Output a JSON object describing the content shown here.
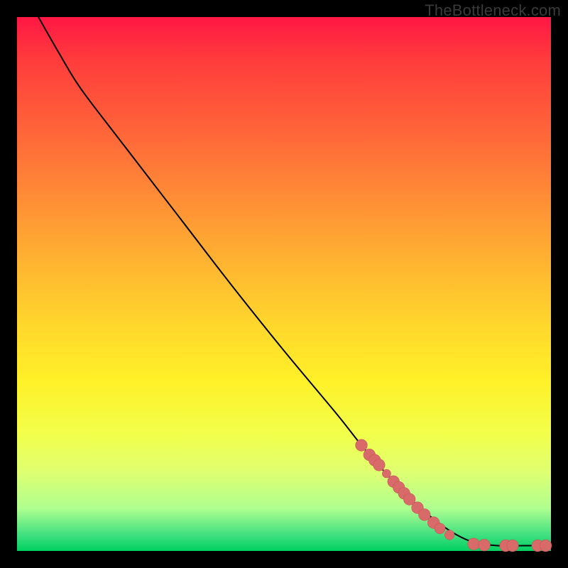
{
  "attribution": "TheBottleneck.com",
  "colors": {
    "background": "#000000",
    "curve": "#000000",
    "marker_fill": "#d86a6a",
    "marker_stroke": "#c75858"
  },
  "chart_data": {
    "type": "line",
    "title": "",
    "xlabel": "",
    "ylabel": "",
    "xlim": [
      0,
      100
    ],
    "ylim": [
      0,
      100
    ],
    "grid": false,
    "legend": false,
    "curve_points_pct": [
      {
        "x": 4,
        "y": 100
      },
      {
        "x": 8,
        "y": 93
      },
      {
        "x": 12,
        "y": 86.5
      },
      {
        "x": 20,
        "y": 76
      },
      {
        "x": 30,
        "y": 63
      },
      {
        "x": 40,
        "y": 50
      },
      {
        "x": 50,
        "y": 37.5
      },
      {
        "x": 60,
        "y": 25.5
      },
      {
        "x": 66,
        "y": 18
      },
      {
        "x": 74,
        "y": 9.5
      },
      {
        "x": 80,
        "y": 4.5
      },
      {
        "x": 85,
        "y": 1.8
      },
      {
        "x": 90,
        "y": 1.0
      },
      {
        "x": 95,
        "y": 1.0
      },
      {
        "x": 99,
        "y": 1.0
      }
    ],
    "markers_pct": [
      {
        "x": 64.5,
        "y": 19.8,
        "r": 1.1
      },
      {
        "x": 66.0,
        "y": 18.0,
        "r": 1.1
      },
      {
        "x": 67.0,
        "y": 17.0,
        "r": 1.1
      },
      {
        "x": 67.8,
        "y": 16.1,
        "r": 1.1
      },
      {
        "x": 69.2,
        "y": 14.5,
        "r": 0.8
      },
      {
        "x": 70.5,
        "y": 13.0,
        "r": 1.1
      },
      {
        "x": 71.5,
        "y": 11.9,
        "r": 1.1
      },
      {
        "x": 72.5,
        "y": 10.8,
        "r": 1.1
      },
      {
        "x": 73.5,
        "y": 9.7,
        "r": 1.1
      },
      {
        "x": 75.0,
        "y": 8.1,
        "r": 1.1
      },
      {
        "x": 76.3,
        "y": 6.8,
        "r": 1.1
      },
      {
        "x": 78.0,
        "y": 5.3,
        "r": 1.1
      },
      {
        "x": 79.2,
        "y": 4.2,
        "r": 1.0
      },
      {
        "x": 81.0,
        "y": 3.0,
        "r": 0.9
      },
      {
        "x": 85.5,
        "y": 1.3,
        "r": 1.1
      },
      {
        "x": 87.5,
        "y": 1.1,
        "r": 1.1
      },
      {
        "x": 91.5,
        "y": 1.0,
        "r": 1.1
      },
      {
        "x": 92.8,
        "y": 1.0,
        "r": 1.1
      },
      {
        "x": 97.5,
        "y": 1.0,
        "r": 1.1
      },
      {
        "x": 99.0,
        "y": 1.0,
        "r": 1.1
      }
    ]
  }
}
